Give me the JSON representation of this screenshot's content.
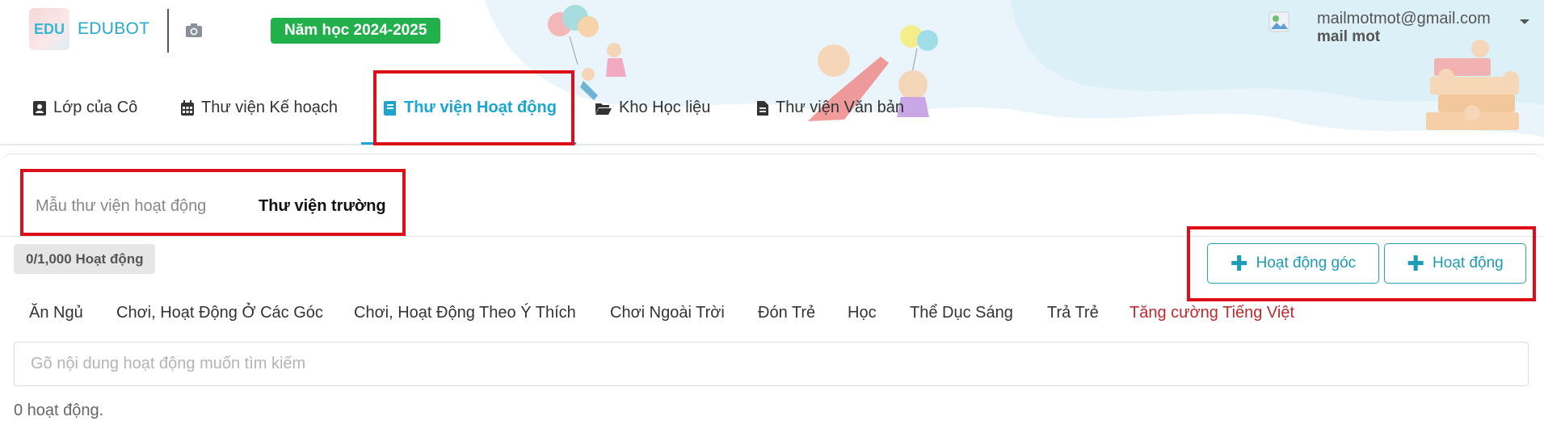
{
  "header": {
    "logo_mark": "EDU",
    "logo_text": "EDUBOT",
    "school_year": "Năm học 2024-2025",
    "camera_icon": "camera-icon"
  },
  "user": {
    "email": "mailmotmot@gmail.com",
    "name": "mail mot",
    "avatar_icon": "avatar-icon",
    "caret_icon": "chevron-down-icon"
  },
  "nav": {
    "items": [
      {
        "label": "Lớp của Cô",
        "icon": "class-icon"
      },
      {
        "label": "Thư viện Kế hoạch",
        "icon": "calendar-icon"
      },
      {
        "label": "Thư viện Hoạt động",
        "icon": "book-icon",
        "active": true
      },
      {
        "label": "Kho Học liệu",
        "icon": "folder-open-icon"
      },
      {
        "label": "Thư viện Văn bản",
        "icon": "document-icon"
      }
    ]
  },
  "library": {
    "subtabs": [
      {
        "label": "Mẫu thư viện hoạt động",
        "active": false
      },
      {
        "label": "Thư viện trường",
        "active": true
      }
    ],
    "count_label": "0/1,000 Hoạt động",
    "buttons": {
      "add_corner_activity": "Hoạt động góc",
      "add_activity": "Hoạt động"
    },
    "categories": [
      "Ăn Ngủ",
      "Chơi, Hoạt Động Ở Các Góc",
      "Chơi, Hoạt Động Theo Ý Thích",
      "Chơi Ngoài Trời",
      "Đón Trẻ",
      "Học",
      "Thể Dục Sáng",
      "Trả Trẻ",
      "Tăng cường Tiếng Việt"
    ],
    "search_placeholder": "Gõ nội dung hoạt động muốn tìm kiếm",
    "search_value": "",
    "result_text": "0 hoạt động."
  },
  "colors": {
    "accent": "#1aa6cf",
    "year_badge": "#21b04b",
    "highlight_category": "#c0282e",
    "annotation": "#dd0f18"
  }
}
